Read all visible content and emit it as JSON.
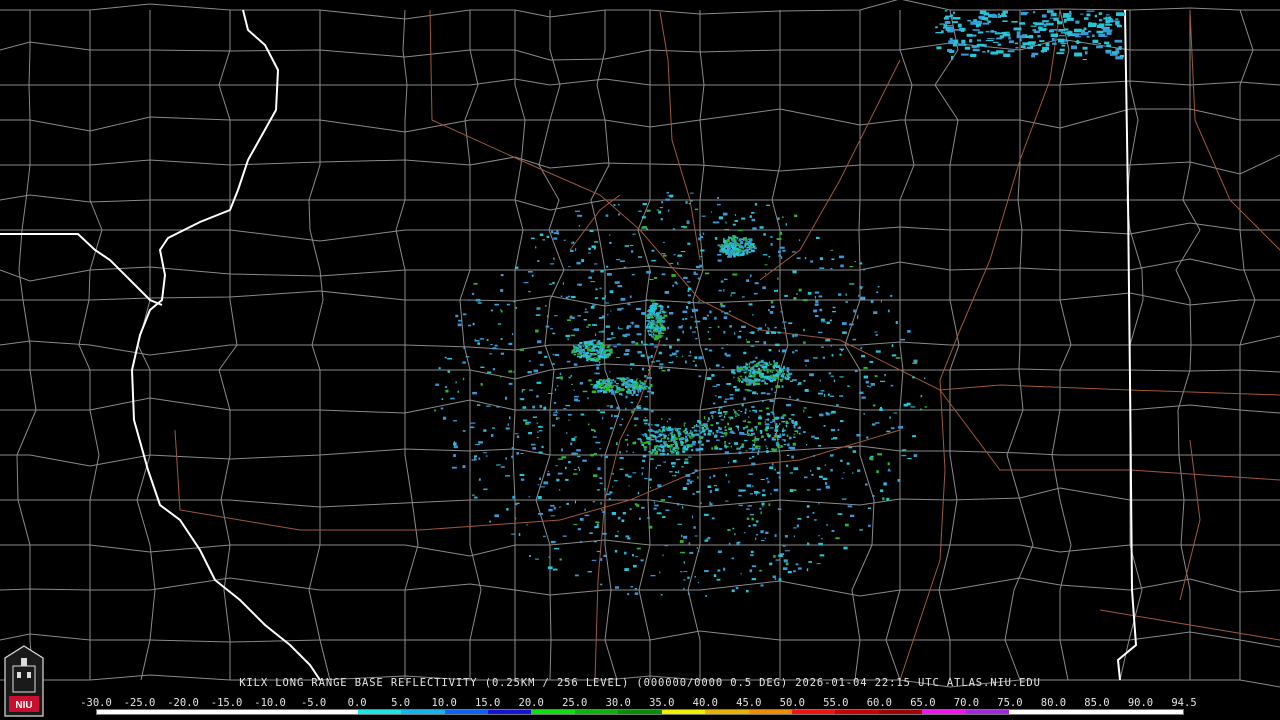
{
  "product_caption": "KILX LONG RANGE BASE REFLECTIVITY (0.25KM / 256 LEVEL) (000000/0000 0.5 DEG) 2026-01-04 22:15 UTC  ATLAS.NIU.EDU",
  "logo_text": "NIU",
  "color_scale": {
    "labels": [
      "-30.0",
      "-25.0",
      "-20.0",
      "-15.0",
      "-10.0",
      "-5.0",
      "0.0",
      "5.0",
      "10.0",
      "15.0",
      "20.0",
      "25.0",
      "30.0",
      "35.0",
      "40.0",
      "45.0",
      "50.0",
      "55.0",
      "60.0",
      "65.0",
      "70.0",
      "75.0",
      "80.0",
      "85.0",
      "90.0",
      "94.5"
    ],
    "colors": [
      "#ffffff",
      "#ffffff",
      "#ffffff",
      "#ffffff",
      "#ffffff",
      "#ffffff",
      "#1ee6e6",
      "#14b4f0",
      "#0a64f0",
      "#1414d2",
      "#10dc10",
      "#0ab40a",
      "#088c08",
      "#f0f000",
      "#e6b400",
      "#f08c00",
      "#f01414",
      "#c80000",
      "#a00000",
      "#f014f0",
      "#a028dc",
      "#ffffff",
      "#ffffff",
      "#ffffff",
      "#ffffff"
    ]
  },
  "colors": {
    "background": "#000000",
    "county_lines": "#8a8a8a",
    "state_lines": "#ffffff",
    "highways": "#a0583a",
    "echo_light": "#3a9ad8",
    "echo_mid": "#26c6d8",
    "echo_strong": "#2fb62f"
  }
}
